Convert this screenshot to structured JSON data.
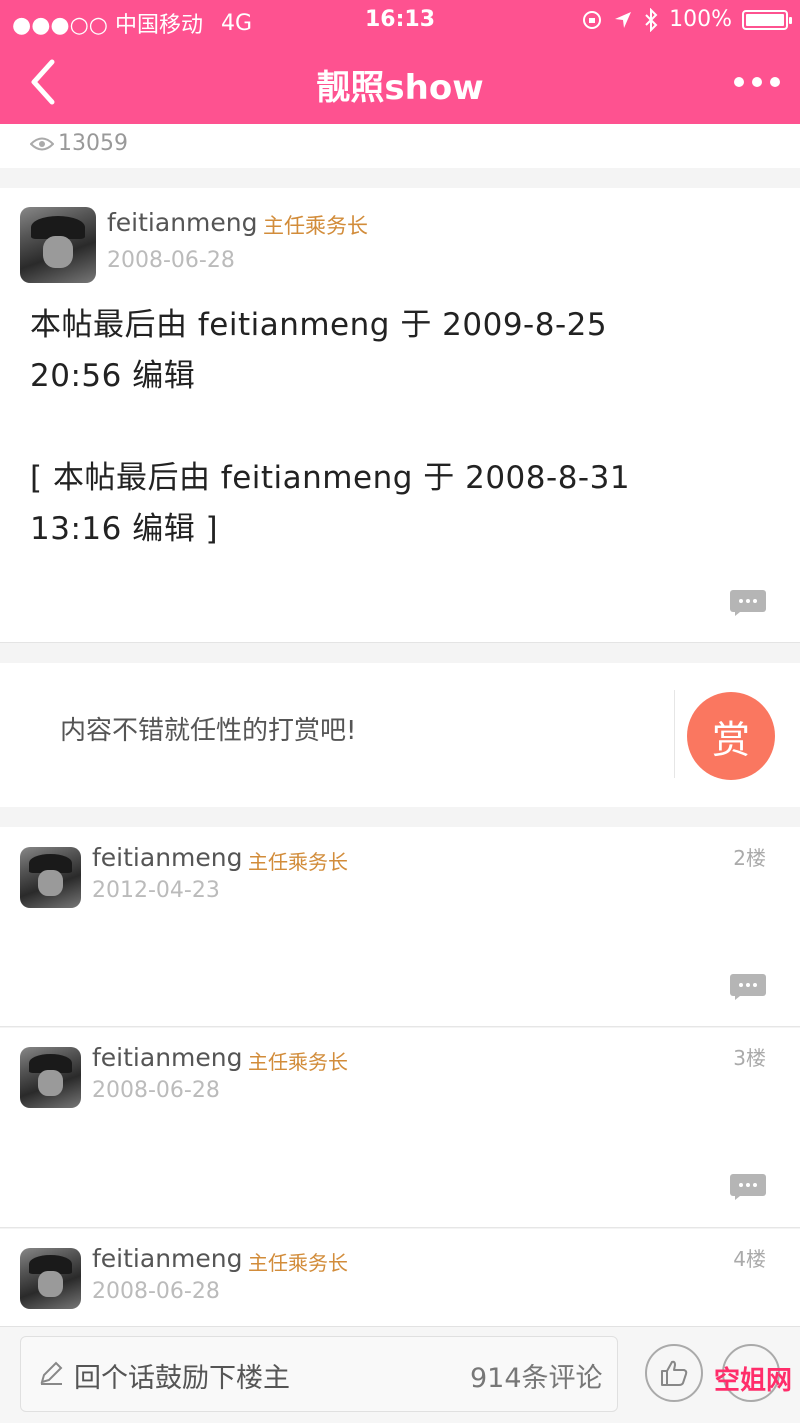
{
  "status_bar": {
    "carrier": "●●●○○ 中国移动",
    "network": "4G",
    "time": "16:13",
    "battery": "100%"
  },
  "nav": {
    "title": "靓照show",
    "back_icon": "chevron-left-icon",
    "more_icon": "more-dots-icon"
  },
  "views": {
    "count": "13059",
    "icon": "eye-icon"
  },
  "post": {
    "author": "feitianmeng",
    "role": "主任乘务长",
    "date": "2008-06-28",
    "body_line1": " 本帖最后由 feitianmeng 于 2009-8-25",
    "body_line2": "20:56 编辑",
    "body_line3": "[ 本帖最后由 feitianmeng 于 2008-8-31",
    "body_line4": "13:16 编辑 ]"
  },
  "reward": {
    "text": "内容不错就任性的打赏吧!",
    "button": "赏"
  },
  "floors": [
    {
      "author": "feitianmeng",
      "role": "主任乘务长",
      "date": "2012-04-23",
      "floor": "2楼"
    },
    {
      "author": "feitianmeng",
      "role": "主任乘务长",
      "date": "2008-06-28",
      "floor": "3楼"
    },
    {
      "author": "feitianmeng",
      "role": "主任乘务长",
      "date": "2008-06-28",
      "floor": "4楼"
    }
  ],
  "bottom": {
    "reply_placeholder": "回个话鼓励下楼主",
    "comment_count": "914条评论",
    "watermark": "空姐网"
  },
  "colors": {
    "brand": "#fe5290",
    "role": "#d28c3a",
    "reward": "#fa7760"
  }
}
